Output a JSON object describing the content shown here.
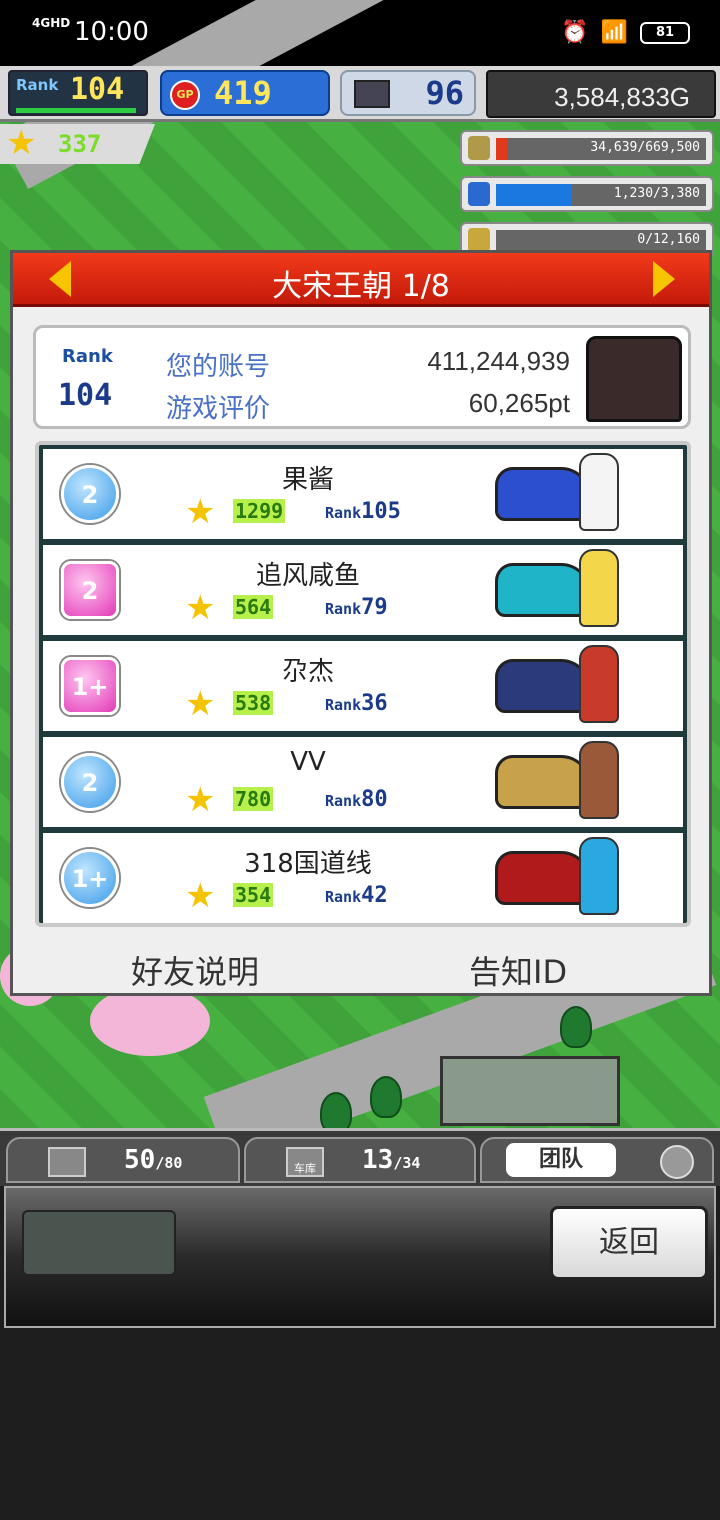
{
  "status_bar": {
    "signal": "4GHD",
    "time": "10:00",
    "battery": "81",
    "icons": [
      "signal-icon",
      "alarm-icon",
      "wifi-icon",
      "battery-icon"
    ]
  },
  "hud": {
    "rank_label": "Rank",
    "rank_value": "104",
    "gp_label": "GP",
    "gp_value": "419",
    "pc_value": "96",
    "gold": "3,584,833G",
    "stars": "337",
    "resources": [
      {
        "name": "coins",
        "text": "34,639/669,500",
        "fill": 0.05,
        "color": "#e03a1a"
      },
      {
        "name": "fuel",
        "text": "1,230/3,380",
        "fill": 0.36,
        "color": "#1a78e0"
      },
      {
        "name": "wheat",
        "text": "0/12,160",
        "fill": 0.0,
        "color": "#e0c81a"
      }
    ]
  },
  "dialog": {
    "title": "大宋王朝 1/8",
    "me": {
      "rank_label": "Rank",
      "rank_value": "104",
      "account_label": "您的账号",
      "account_value": "411,244,939",
      "rating_label": "游戏评价",
      "rating_value": "60,265pt"
    },
    "friends": [
      {
        "badge": "2",
        "badge_style": "blue",
        "name": "果酱",
        "stars": "1299",
        "rank_label": "Rank",
        "rank": "105",
        "car_color": "#2c4fd0",
        "driver_color": "#f4f4f4"
      },
      {
        "badge": "2",
        "badge_style": "pink",
        "name": "追风咸鱼",
        "stars": "564",
        "rank_label": "Rank",
        "rank": "79",
        "car_color": "#1fb4c8",
        "driver_color": "#f3d64a"
      },
      {
        "badge": "1+",
        "badge_style": "pink",
        "name": "尕杰",
        "stars": "538",
        "rank_label": "Rank",
        "rank": "36",
        "car_color": "#2a3a7a",
        "driver_color": "#c83a2a"
      },
      {
        "badge": "2",
        "badge_style": "blue",
        "name": "VV",
        "stars": "780",
        "rank_label": "Rank",
        "rank": "80",
        "car_color": "#c8a24a",
        "driver_color": "#9a5a3a"
      },
      {
        "badge": "1+",
        "badge_style": "blue",
        "name": "318国道线",
        "stars": "354",
        "rank_label": "Rank",
        "rank": "42",
        "car_color": "#b01a1a",
        "driver_color": "#2aa8e0"
      }
    ],
    "friend_info_button": "好友说明",
    "share_id_button": "告知ID"
  },
  "tabs": {
    "storage_value": "50",
    "storage_max": "80",
    "garage_label": "车库",
    "garage_value": "13",
    "garage_max": "34",
    "team_label": "团队"
  },
  "bottom": {
    "back_button": "返回"
  }
}
